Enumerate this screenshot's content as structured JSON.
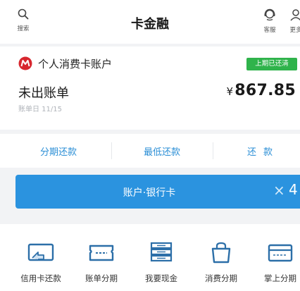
{
  "header": {
    "title": "卡金融",
    "search_label": "搜索",
    "service_label": "客服",
    "more_label": "更多"
  },
  "account": {
    "name": "个人消费卡账户",
    "badge": "上期已还清",
    "status": "未出账单",
    "bill_date": "账单日 11/15",
    "currency_symbol": "¥",
    "amount": "867.85"
  },
  "actions": [
    {
      "label": "分期还款"
    },
    {
      "label": "最低还款"
    },
    {
      "label": "还款"
    }
  ],
  "banner": {
    "text": "账户·银行卡",
    "close_symbol": "×",
    "count": "4"
  },
  "grid": [
    {
      "label": "信用卡还款",
      "icon": "card-repay-icon"
    },
    {
      "label": "账单分期",
      "icon": "bill-installment-icon"
    },
    {
      "label": "我要现金",
      "icon": "cash-icon"
    },
    {
      "label": "消费分期",
      "icon": "shopping-bag-icon"
    },
    {
      "label": "掌上分期",
      "icon": "mobile-installment-icon"
    }
  ],
  "colors": {
    "accent": "#2c8fd6",
    "banner": "#2b93df",
    "badge": "#2fb34b",
    "brand_red": "#d7262e"
  }
}
